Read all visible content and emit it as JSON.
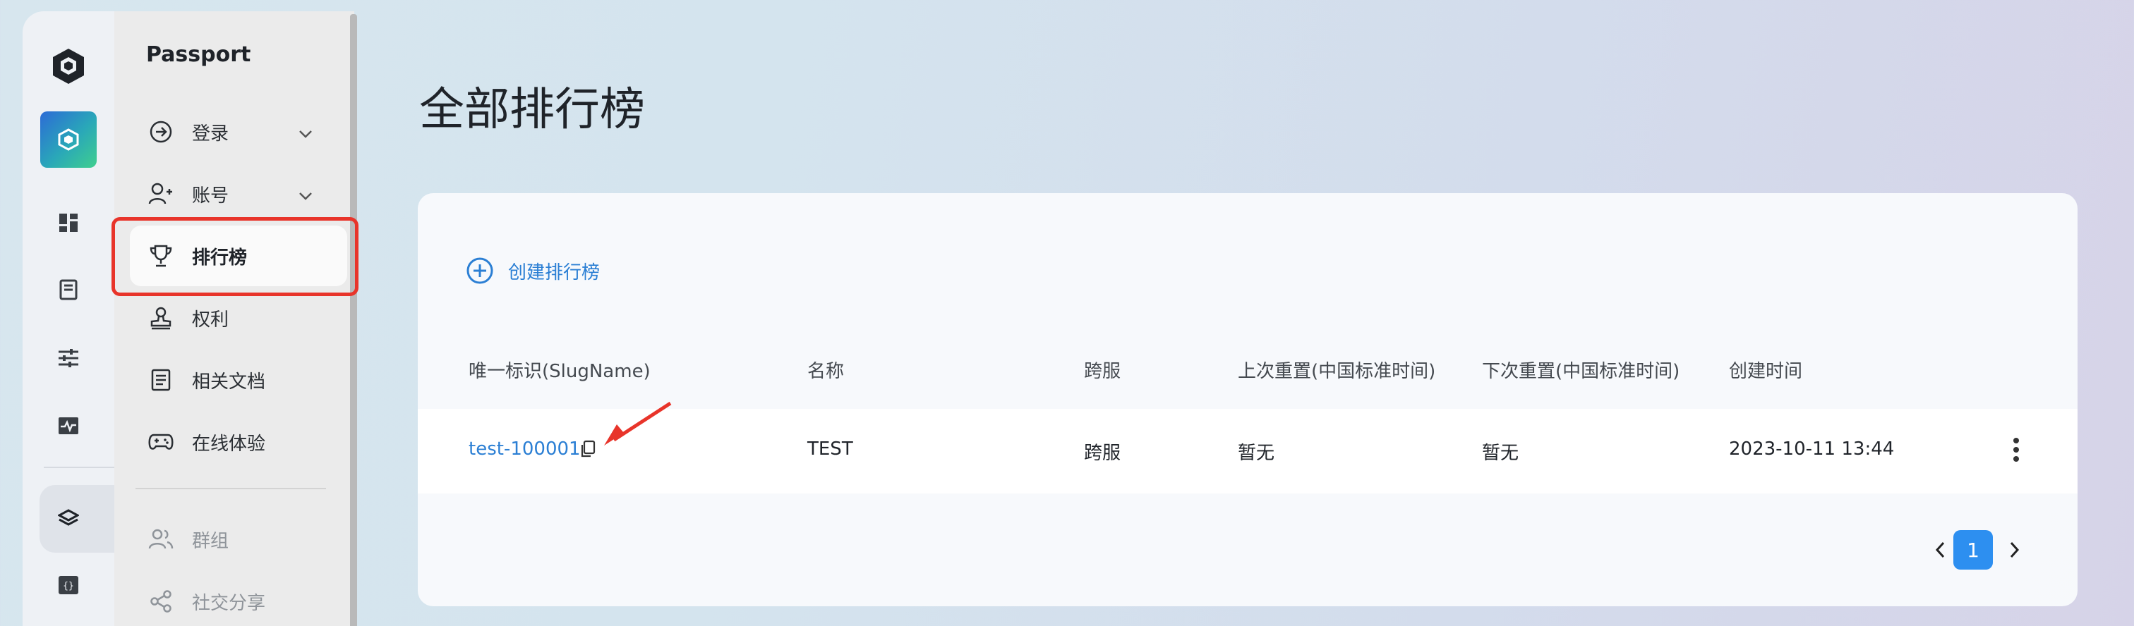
{
  "app": {
    "name": "Passport"
  },
  "nav": {
    "items": [
      {
        "label": "登录",
        "icon": "login-arrow-icon",
        "expandable": true
      },
      {
        "label": "账号",
        "icon": "user-add-icon",
        "expandable": true
      },
      {
        "label": "排行榜",
        "icon": "trophy-icon",
        "active": true
      },
      {
        "label": "权利",
        "icon": "stamp-icon"
      },
      {
        "label": "相关文档",
        "icon": "document-icon"
      },
      {
        "label": "在线体验",
        "icon": "gamepad-icon"
      },
      {
        "label": "群组",
        "icon": "users-icon",
        "muted": true
      },
      {
        "label": "社交分享",
        "icon": "share-icon",
        "muted": true
      }
    ]
  },
  "rail": {
    "icons": [
      "unity-logo-icon",
      "app-cube-icon",
      "dashboard-icon",
      "guide-book-icon",
      "sliders-icon",
      "monitor-pulse-icon",
      "layers-icon",
      "code-braces-icon"
    ]
  },
  "main": {
    "title": "全部排行榜",
    "create_label": "创建排行榜",
    "columns": [
      "唯一标识(SlugName)",
      "名称",
      "跨服",
      "上次重置(中国标准时间)",
      "下次重置(中国标准时间)",
      "创建时间"
    ],
    "rows": [
      {
        "slug": "test-100001",
        "name": "TEST",
        "cross_server": "跨服",
        "last_reset": "暂无",
        "next_reset": "暂无",
        "created": "2023-10-11 13:44"
      }
    ],
    "pagination": {
      "current_page": "1"
    }
  },
  "colors": {
    "accent": "#2b7fd4",
    "highlight": "#e8342a",
    "page_active": "#2d8ff0"
  }
}
